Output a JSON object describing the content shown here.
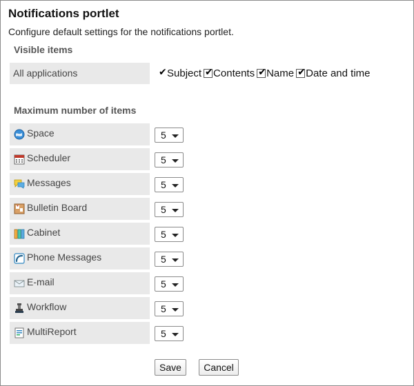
{
  "page": {
    "title": "Notifications portlet",
    "description": "Configure default settings for the notifications portlet."
  },
  "visible_items": {
    "heading": "Visible items",
    "row_label": "All applications",
    "options": [
      {
        "label": "Subject",
        "checked": true
      },
      {
        "label": "Contents",
        "checked": true
      },
      {
        "label": "Name",
        "checked": true
      },
      {
        "label": "Date and time",
        "checked": true
      }
    ]
  },
  "max_items": {
    "heading": "Maximum number of items",
    "rows": [
      {
        "label": "Space",
        "icon": "space-icon",
        "value": "5"
      },
      {
        "label": "Scheduler",
        "icon": "scheduler-icon",
        "value": "5"
      },
      {
        "label": "Messages",
        "icon": "messages-icon",
        "value": "5"
      },
      {
        "label": "Bulletin Board",
        "icon": "bulletin-board-icon",
        "value": "5"
      },
      {
        "label": "Cabinet",
        "icon": "cabinet-icon",
        "value": "5"
      },
      {
        "label": "Phone Messages",
        "icon": "phone-messages-icon",
        "value": "5"
      },
      {
        "label": "E-mail",
        "icon": "email-icon",
        "value": "5"
      },
      {
        "label": "Workflow",
        "icon": "workflow-icon",
        "value": "5"
      },
      {
        "label": "MultiReport",
        "icon": "multireport-icon",
        "value": "5"
      }
    ]
  },
  "buttons": {
    "save": "Save",
    "cancel": "Cancel"
  }
}
